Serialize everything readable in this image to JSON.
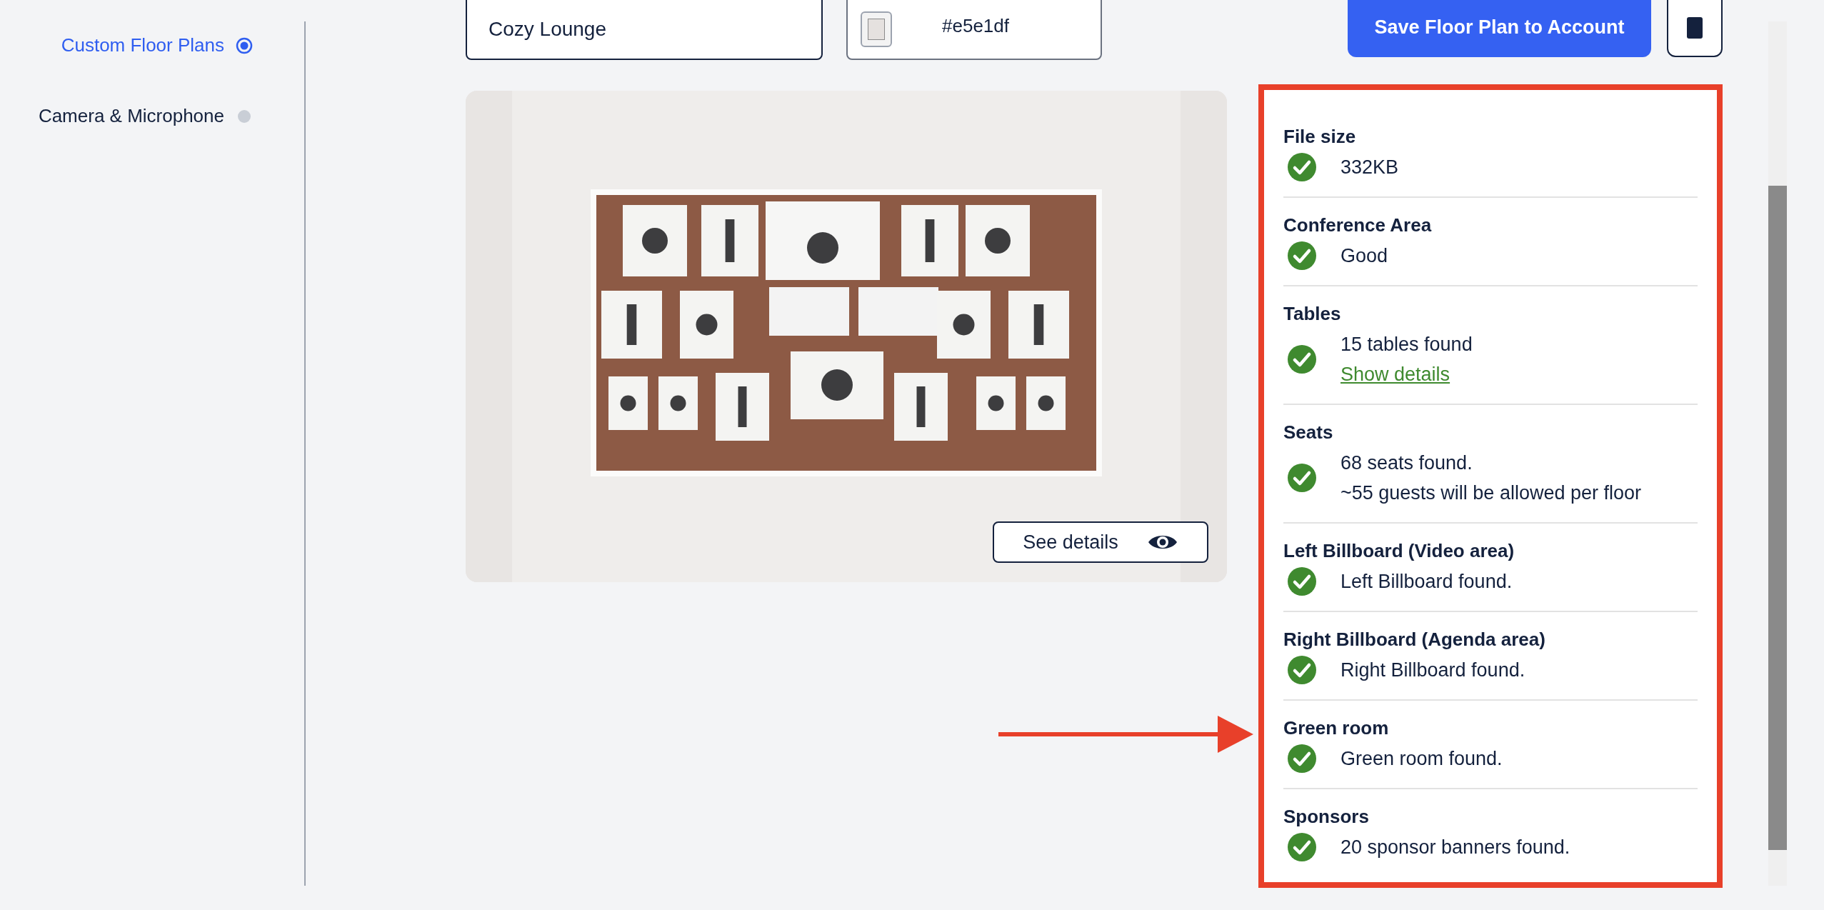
{
  "sidebar": {
    "items": [
      {
        "label": "Custom Floor Plans",
        "selected": true
      },
      {
        "label": "Camera & Microphone",
        "selected": false
      }
    ]
  },
  "floor_plan_name": {
    "value": "Cozy Lounge"
  },
  "background_color": {
    "value": "#e5e1df"
  },
  "save_button": "Save Floor Plan to Account",
  "preview": {
    "kind": "picture",
    "see_details_button": "See details"
  },
  "checks": [
    {
      "title": "File size",
      "passed": true,
      "lines": [
        "332KB"
      ]
    },
    {
      "title": "Conference Area",
      "passed": true,
      "lines": [
        "Good"
      ]
    },
    {
      "title": "Tables",
      "passed": true,
      "lines": [
        "15 tables found"
      ],
      "link": "Show details"
    },
    {
      "title": "Seats",
      "passed": true,
      "lines": [
        "68 seats found.",
        "~55 guests will be allowed per floor"
      ]
    },
    {
      "title": "Left Billboard (Video area)",
      "passed": true,
      "lines": [
        "Left Billboard found."
      ]
    },
    {
      "title": "Right Billboard (Agenda area)",
      "passed": true,
      "lines": [
        "Right Billboard found."
      ]
    },
    {
      "title": "Green room",
      "passed": true,
      "lines": [
        "Green room found."
      ]
    },
    {
      "title": "Sponsors",
      "passed": true,
      "lines": [
        "20 sponsor banners found."
      ]
    }
  ]
}
